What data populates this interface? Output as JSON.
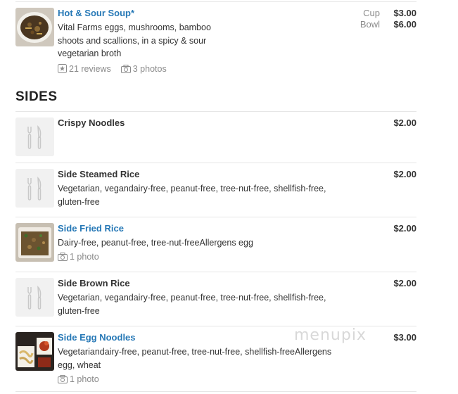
{
  "top_item": {
    "title": "Hot & Sour Soup*",
    "desc_lines": [
      "Vital Farms eggs, mushrooms, bamboo",
      "shoots and scallions, in a spicy & sour",
      "vegetarian broth"
    ],
    "reviews": "21 reviews",
    "photos": "3 photos",
    "prices": [
      {
        "label": "Cup",
        "value": "$3.00"
      },
      {
        "label": "Bowl",
        "value": "$6.00"
      }
    ]
  },
  "section": {
    "title": "SIDES"
  },
  "items": [
    {
      "title": "Crispy Noodles",
      "desc_lines": [],
      "price": "$2.00",
      "photos": ""
    },
    {
      "title": "Side Steamed Rice",
      "desc_lines": [
        "Vegetarian, vegandairy-free, peanut-free, tree-nut-free, shellfish-free,",
        "gluten-free"
      ],
      "price": "$2.00",
      "photos": ""
    },
    {
      "title": "Side Fried Rice",
      "desc_lines": [
        "Dairy-free, peanut-free, tree-nut-freeAllergens egg"
      ],
      "price": "$2.00",
      "photos": "1 photo"
    },
    {
      "title": "Side Brown Rice",
      "desc_lines": [
        "Vegetarian, vegandairy-free, peanut-free, tree-nut-free, shellfish-free,",
        "gluten-free"
      ],
      "price": "$2.00",
      "photos": ""
    },
    {
      "title": "Side Egg Noodles",
      "desc_lines": [
        "Vegetariandairy-free, peanut-free, tree-nut-free, shellfish-freeAllergens",
        "egg, wheat"
      ],
      "price": "$3.00",
      "photos": "1 photo"
    }
  ],
  "watermark": "menupix",
  "colors": {
    "link": "#2678b6",
    "text": "#333333",
    "muted": "#8a8a8a",
    "separator": "#e6e6e6"
  },
  "icons": [
    "star-icon",
    "camera-icon",
    "fork-knife-icon"
  ]
}
